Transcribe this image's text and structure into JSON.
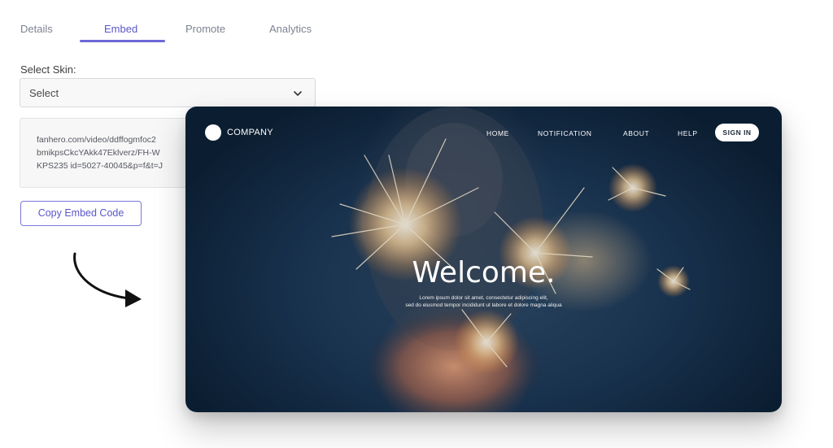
{
  "tabs": [
    {
      "label": "Details"
    },
    {
      "label": "Embed"
    },
    {
      "label": "Promote"
    },
    {
      "label": "Analytics"
    }
  ],
  "active_tab": "Embed",
  "skin": {
    "label": "Select Skin:",
    "selected": "Select"
  },
  "embed_code": {
    "lines": [
      "fanhero.com/video/ddffogmfoc2",
      "bmikpsCkcYAkk47Eklverz/FH-W",
      "KPS235 id=5027-40045&p=f&t=J"
    ]
  },
  "copy_button": {
    "label": "Copy Embed Code"
  },
  "preview": {
    "company": "COMPANY",
    "nav": [
      "HOME",
      "NOTIFICATION",
      "ABOUT",
      "HELP"
    ],
    "signin": "SIGN IN",
    "headline": "Welcome.",
    "subtext": [
      "Lorem ipsum dolor sit amet, consectetur adipiscing elit,",
      "sed do eiusmod tempor incididunt ut labore et dolore magna aliqua"
    ]
  },
  "colors": {
    "accent": "#6c68d6",
    "tab_inactive": "#7d8392",
    "preview_bg": "#1b3552"
  }
}
